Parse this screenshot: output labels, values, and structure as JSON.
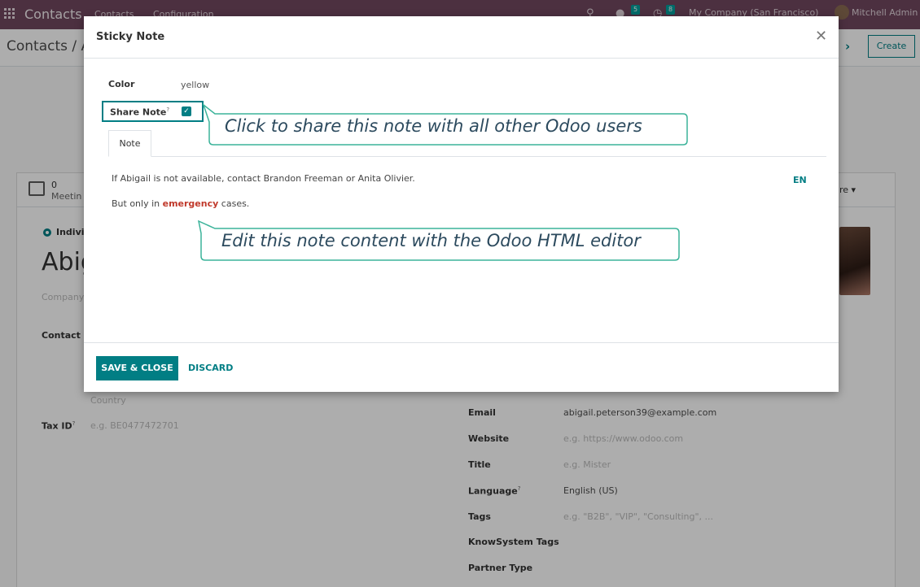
{
  "navbar": {
    "app_title": "Contacts",
    "menu": [
      "Contacts",
      "Configuration"
    ],
    "chat_count": "5",
    "activity_count": "8",
    "company": "My Company (San Francisco)",
    "user": "Mitchell Admin"
  },
  "control_panel": {
    "breadcrumb": "Contacts / A",
    "create_label": "Create"
  },
  "form": {
    "button_box": {
      "meetings_count": "0",
      "meetings_label": "Meetin",
      "more_label": "re ▾"
    },
    "type_label": "Indivi",
    "name": "Abig",
    "company_placeholder": "Company",
    "contact_label": "Contact",
    "country_placeholder": "Country",
    "tax_id_label": "Tax ID",
    "tax_id_placeholder": "e.g. BE0477472701",
    "fields": [
      {
        "label": "Email",
        "value": "abigail.peterson39@example.com",
        "placeholder": false
      },
      {
        "label": "Website",
        "value": "e.g. https://www.odoo.com",
        "placeholder": true
      },
      {
        "label": "Title",
        "value": "e.g. Mister",
        "placeholder": true
      },
      {
        "label": "Language",
        "value": "English (US)",
        "placeholder": false
      },
      {
        "label": "Tags",
        "value": "e.g. \"B2B\", \"VIP\", \"Consulting\", ...",
        "placeholder": true
      },
      {
        "label": "KnowSystem Tags",
        "value": "",
        "placeholder": false
      },
      {
        "label": "Partner Type",
        "value": "",
        "placeholder": false
      }
    ]
  },
  "modal": {
    "title": "Sticky Note",
    "color_label": "Color",
    "color_value": "yellow",
    "share_label": "Share Note",
    "share_checked": true,
    "tab_label": "Note",
    "note_line1": "If Abigail is not available, contact Brandon Freeman or Anita Olivier.",
    "note_line2_prefix": "But only in ",
    "note_line2_emphasis": "emergency",
    "note_line2_suffix": " cases.",
    "lang_button": "EN",
    "save_label": "SAVE & CLOSE",
    "discard_label": "DISCARD"
  },
  "callouts": {
    "share": "Click to share this note with all other Odoo users",
    "editor": "Edit this note content with the Odoo HTML editor"
  },
  "colors": {
    "navbar": "#71475f",
    "accent": "#017e84",
    "emphasis": "#c0392b",
    "callout_border": "#3bb39a"
  }
}
